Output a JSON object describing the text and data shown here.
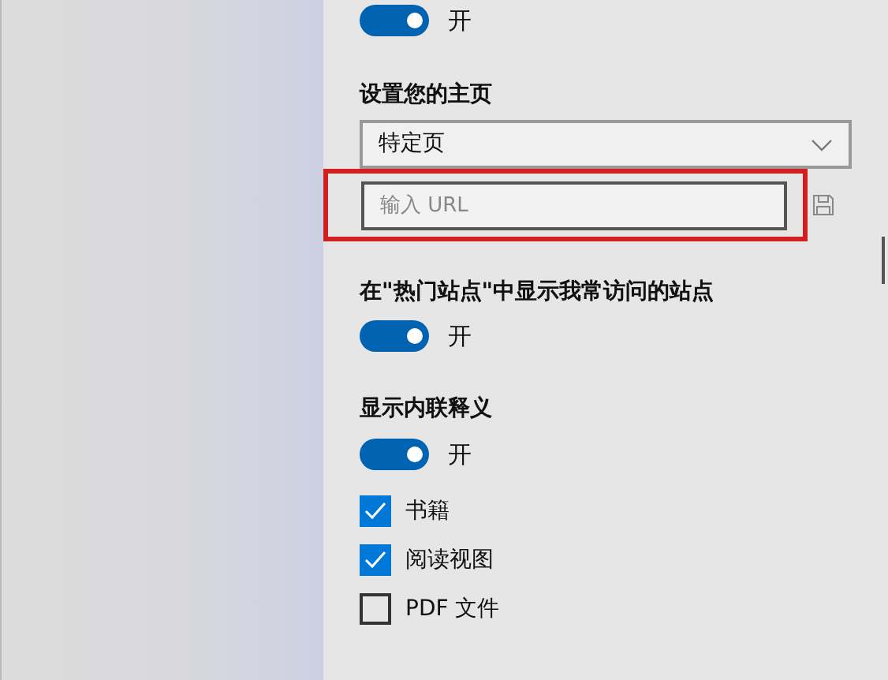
{
  "top_toggle": {
    "on": true,
    "label": "开"
  },
  "homepage": {
    "heading": "设置您的主页",
    "dropdown": {
      "value": "特定页"
    },
    "url_field": {
      "placeholder": "输入 URL",
      "highlighted": true
    }
  },
  "top_sites": {
    "heading": "在\"热门站点\"中显示我常访问的站点",
    "toggle": {
      "on": true,
      "label": "开"
    }
  },
  "inline_definitions": {
    "heading": "显示内联释义",
    "toggle": {
      "on": true,
      "label": "开"
    },
    "options": [
      {
        "label": "书籍",
        "checked": true
      },
      {
        "label": "阅读视图",
        "checked": true
      },
      {
        "label": "PDF 文件",
        "checked": false
      }
    ]
  }
}
